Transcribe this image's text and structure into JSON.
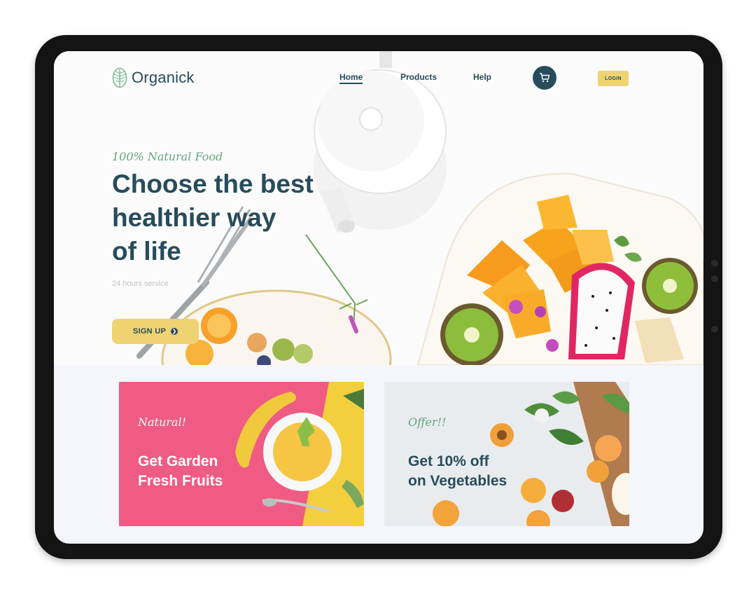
{
  "brand": {
    "name": "Organick",
    "logo_icon": "leaf-logo-icon"
  },
  "nav": {
    "items": [
      "Home",
      "Products",
      "Help"
    ],
    "active": "Home",
    "cart_icon": "shopping-cart-icon",
    "login_label": "LOGIN"
  },
  "hero": {
    "tagline": "100% Natural Food",
    "headline_lines": [
      "Choose the best",
      "healthier way",
      "of life"
    ],
    "subtext": "24 hours service",
    "signup_label": "SIGN UP",
    "signup_icon": "arrow-right-circle-icon"
  },
  "promos": [
    {
      "script": "Natural!",
      "title_lines": [
        "Get Garden",
        "Fresh Fruits"
      ]
    },
    {
      "script": "Offer!!",
      "title_lines": [
        "Get 10% off",
        "on Vegetables"
      ]
    }
  ],
  "colors": {
    "primary": "#274c5b",
    "accent_yellow": "#efd372",
    "accent_green": "#68a47f",
    "promo_pink": "#ef5b83",
    "promo_gray": "#e9ecef",
    "device_frame": "#141414"
  }
}
